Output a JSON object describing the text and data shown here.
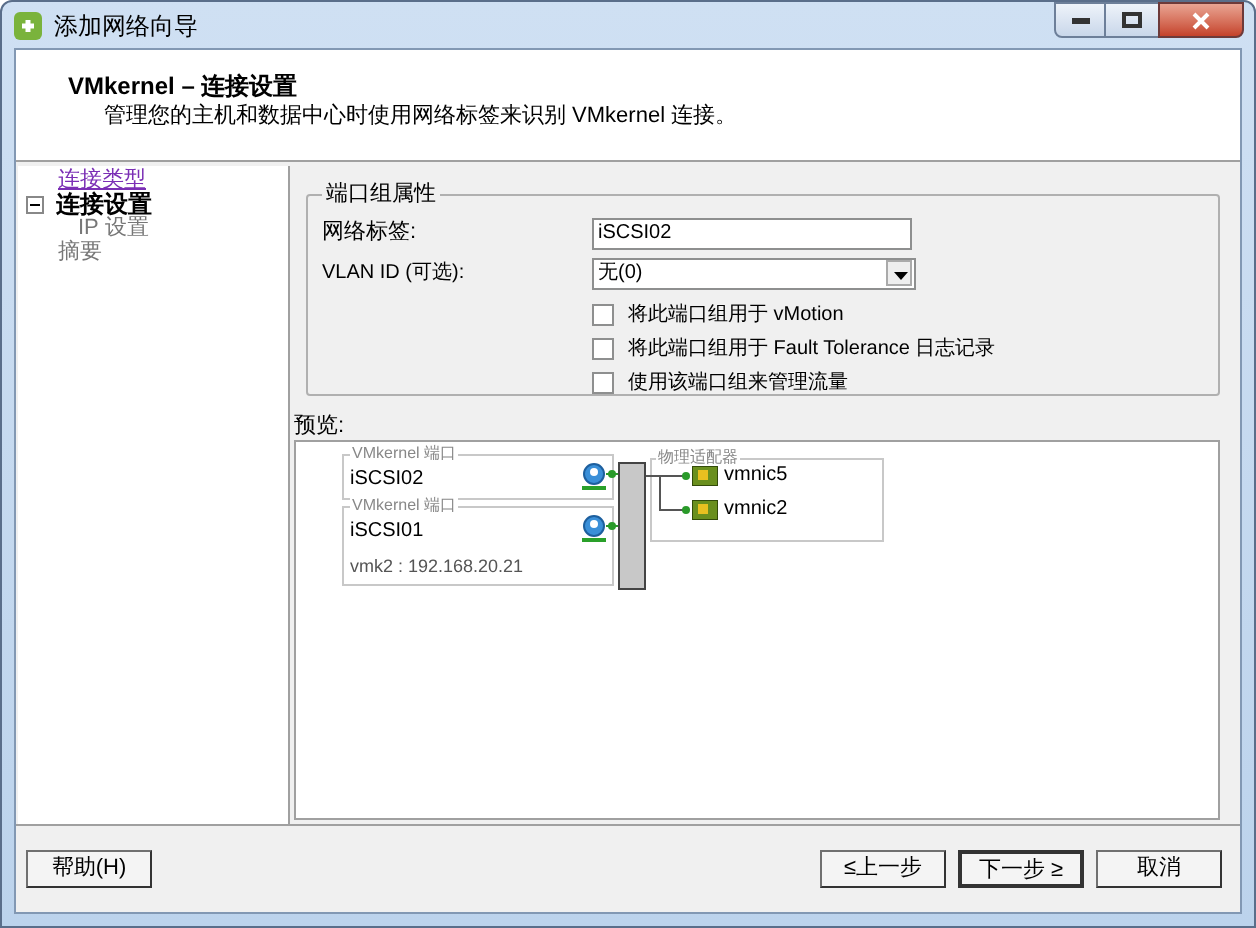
{
  "window": {
    "title": "添加网络向导"
  },
  "header": {
    "title": "VMkernel – 连接设置",
    "subtitle": "管理您的主机和数据中心时使用网络标签来识别 VMkernel 连接。"
  },
  "nav": [
    {
      "label": "连接类型",
      "kind": "visited"
    },
    {
      "label": "连接设置",
      "kind": "current",
      "expanded": true,
      "children": [
        {
          "label": "IP 设置",
          "kind": "pending"
        }
      ]
    },
    {
      "label": "摘要",
      "kind": "pending"
    }
  ],
  "port_group": {
    "title": "端口组属性",
    "network_label": {
      "label": "网络标签:",
      "value": "iSCSI02"
    },
    "vlan": {
      "label": "VLAN ID (可选):",
      "value": "无(0)"
    },
    "options": [
      {
        "label": "将此端口组用于 vMotion",
        "checked": false
      },
      {
        "label": "将此端口组用于 Fault Tolerance 日志记录",
        "checked": false
      },
      {
        "label": "使用该端口组来管理流量",
        "checked": false
      }
    ]
  },
  "preview": {
    "label": "预览:",
    "ports": [
      {
        "group_label": "VMkernel 端口",
        "name": "iSCSI02"
      },
      {
        "group_label": "VMkernel 端口",
        "name": "iSCSI01",
        "detail": "vmk2 : 192.168.20.21"
      }
    ],
    "adapters": {
      "group_label": "物理适配器",
      "items": [
        "vmnic5",
        "vmnic2"
      ]
    }
  },
  "buttons": {
    "help": "帮助(H)",
    "back": "≤上一步",
    "next": "下一步 ≥",
    "cancel": "取消"
  }
}
